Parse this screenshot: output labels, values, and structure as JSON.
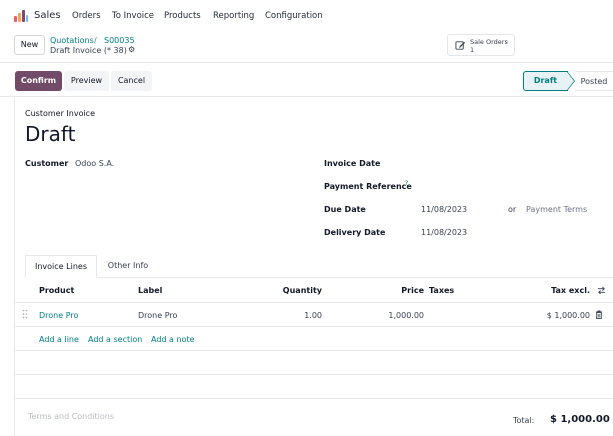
{
  "app": {
    "name": "Sales",
    "logo_colors": [
      "#f06050",
      "#f4a460",
      "#6cc1ed",
      "#814968"
    ]
  },
  "nav": {
    "items": [
      "Orders",
      "To Invoice",
      "Products",
      "Reporting",
      "Configuration"
    ]
  },
  "control_panel": {
    "new_label": "New",
    "breadcrumb": [
      "Quotations",
      "S00035"
    ],
    "breadcrumb_separator": "/",
    "current_record": "Draft Invoice (* 38)",
    "smart_button": {
      "label": "Sale Orders",
      "count": "1",
      "icon": "pencil-square-icon"
    }
  },
  "actions": {
    "confirm_label": "Confirm",
    "preview_label": "Preview",
    "cancel_label": "Cancel"
  },
  "status_bar": {
    "stages": [
      "Draft",
      "Posted"
    ],
    "current": "Draft"
  },
  "form": {
    "doc_type": "Customer Invoice",
    "title": "Draft",
    "customer_label": "Customer",
    "customer_value": "Odoo S.A.",
    "invoice_date_label": "Invoice Date",
    "invoice_date_value": "",
    "payment_ref_label": "Payment Reference",
    "payment_ref_help": "?",
    "due_date_label": "Due Date",
    "due_date_value": "11/08/2023",
    "or_text": "or",
    "payment_terms_placeholder": "Payment Terms",
    "delivery_date_label": "Delivery Date",
    "delivery_date_value": "11/08/2023"
  },
  "tabs": [
    "Invoice Lines",
    "Other Info"
  ],
  "table": {
    "headers": {
      "product": "Product",
      "label": "Label",
      "quantity": "Quantity",
      "price": "Price",
      "taxes": "Taxes",
      "tax_excl": "Tax excl."
    },
    "rows": [
      {
        "product": "Drone Pro",
        "label": "Drone Pro",
        "quantity": "1.00",
        "price": "1,000.00",
        "taxes": "",
        "tax_excl": "$ 1,000.00"
      }
    ],
    "add_links": [
      "Add a line",
      "Add a section",
      "Add a note"
    ]
  },
  "footer": {
    "terms_placeholder": "Terms and Conditions",
    "total_label": "Total:",
    "total_value": "$ 1,000.00"
  },
  "colors": {
    "accent": "#714b67",
    "link": "#017e84"
  }
}
